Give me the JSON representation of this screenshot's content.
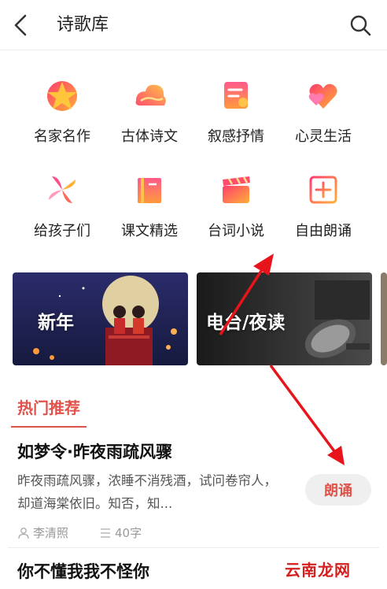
{
  "header": {
    "title": "诗歌库",
    "back_icon": "chevron-left-icon",
    "search_icon": "search-icon"
  },
  "categories": [
    {
      "label": "名家名作",
      "icon": "star-icon"
    },
    {
      "label": "古体诗文",
      "icon": "cloud-icon"
    },
    {
      "label": "叙感抒情",
      "icon": "scroll-icon"
    },
    {
      "label": "心灵生活",
      "icon": "hearts-icon"
    },
    {
      "label": "给孩子们",
      "icon": "pinwheel-icon"
    },
    {
      "label": "课文精选",
      "icon": "book-icon"
    },
    {
      "label": "台词小说",
      "icon": "clapperboard-icon"
    },
    {
      "label": "自由朗诵",
      "icon": "plus-square-icon"
    }
  ],
  "banners": [
    {
      "label": "新年"
    },
    {
      "label": "电台/夜读"
    }
  ],
  "section": {
    "tab_label": "热门推荐"
  },
  "poems": [
    {
      "title": "如梦令·昨夜雨疏风骤",
      "excerpt": "昨夜雨疏风骤，浓睡不消残酒，试问卷帘人，却道海棠依旧。知否，知...",
      "author": "李清照",
      "word_count": "40字",
      "action_label": "朗诵"
    },
    {
      "title": "你不懂我我不怪你"
    }
  ],
  "watermark": "云南龙网",
  "colors": {
    "accent": "#e0524a",
    "arrow": "#e8141b",
    "icon_gradient_start": "#ff3d6e",
    "icon_gradient_end": "#ffb037"
  }
}
